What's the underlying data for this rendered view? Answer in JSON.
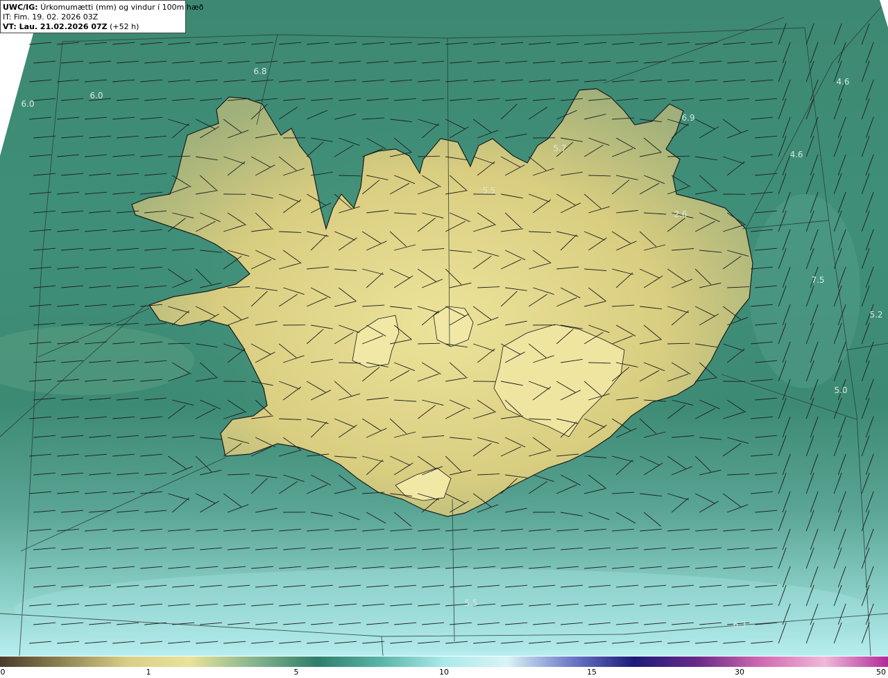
{
  "info": {
    "product": "UWC/IG:",
    "description": "Úrkomumætti (mm) og vindur í 100m hæð",
    "init_time": "IT: Fim. 19. 02. 2026 03Z",
    "valid_label": "VT: Lau. 21.02.2026 07Z",
    "lead_time": "(+52 h)"
  },
  "colorbar": {
    "ticks": [
      "0",
      "1",
      "5",
      "10",
      "15",
      "30",
      "50"
    ],
    "colors": [
      "#4a3a2a",
      "#8f8552",
      "#d8cf86",
      "#e9e39a",
      "#86b58d",
      "#2e7d6b",
      "#5ab5a8",
      "#aaeaea",
      "#d8f4f6",
      "#6e7bc8",
      "#1a1a7a",
      "#6a2a8a",
      "#d06ab0",
      "#f0b8d8",
      "#b02a9a"
    ]
  },
  "map": {
    "theme": {
      "sea": "#3f8c78",
      "land_low": "#c9bd70",
      "land_high": "#efe49a",
      "coast": "#1a1a1a",
      "grid": "#2a3a38",
      "barb": "#1e1e1e"
    },
    "labels": [
      "6.8",
      "6.0",
      "6.0",
      "6.9",
      "4.6",
      "5.7",
      "4.6",
      "5.5",
      "2.6",
      "7.5",
      "5.2",
      "5.0",
      "5.5",
      "6.3"
    ]
  }
}
